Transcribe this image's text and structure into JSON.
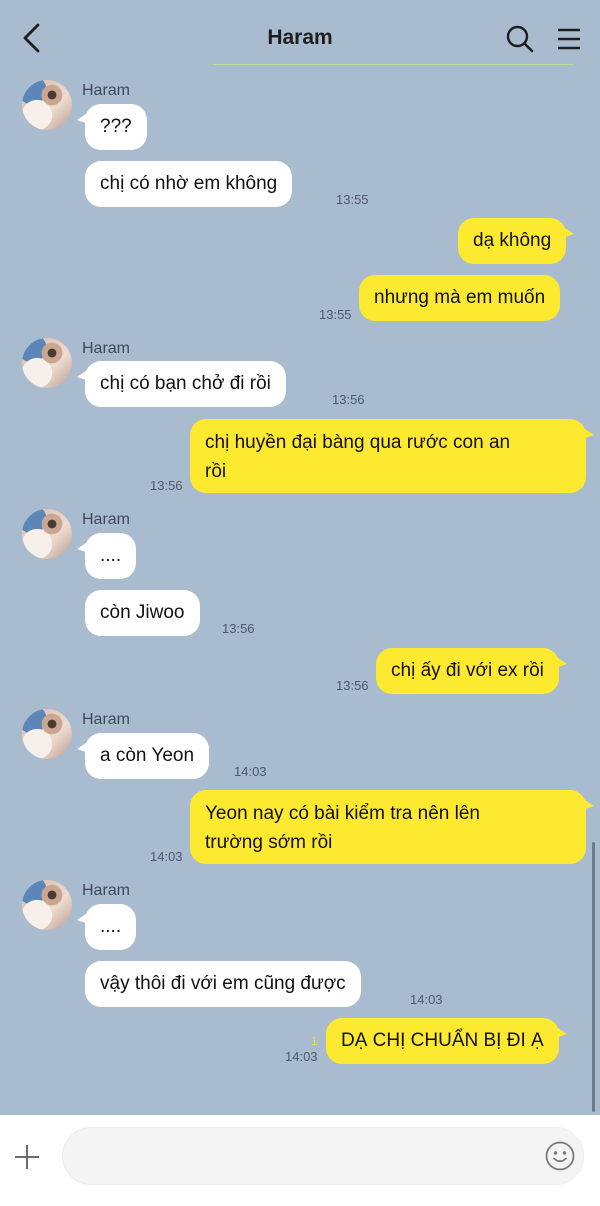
{
  "header": {
    "title": "Haram"
  },
  "contact": {
    "name": "Haram"
  },
  "messages": [
    {
      "from": "in",
      "text": "???"
    },
    {
      "from": "in",
      "text": "chị có nhờ em không",
      "time": "13:55"
    },
    {
      "from": "out",
      "text": "dạ không"
    },
    {
      "from": "out",
      "text": "nhưng mà em muốn",
      "time": "13:55"
    },
    {
      "from": "in",
      "text": "chị có bạn chở đi rồi",
      "time": "13:56"
    },
    {
      "from": "out",
      "text": "chị huyền đại bàng qua rước con an",
      "text2": "rồi",
      "time": "13:56"
    },
    {
      "from": "in",
      "text": "....",
      "time": ""
    },
    {
      "from": "in",
      "text": "còn Jiwoo",
      "time": "13:56"
    },
    {
      "from": "out",
      "text": "chị ấy đi với ex rồi",
      "time": "13:56"
    },
    {
      "from": "in",
      "text": "a còn Yeon",
      "time": "14:03"
    },
    {
      "from": "out",
      "text": "Yeon nay có bài kiểm tra nên lên",
      "text2": "trường sớm rồi",
      "time": "14:03"
    },
    {
      "from": "in",
      "text": "...."
    },
    {
      "from": "in",
      "text": "vậy thôi đi với em cũng được",
      "time": "14:03"
    },
    {
      "from": "out",
      "text": "DẠ CHỊ CHUẨN BỊ ĐI Ạ",
      "time": "14:03",
      "unread": "1"
    }
  ],
  "input": {
    "placeholder": "",
    "value": ""
  },
  "icons": {
    "back": "chevron-left-icon",
    "search": "search-icon",
    "menu": "menu-icon",
    "plus": "plus-icon",
    "emoji": "emoji-icon"
  },
  "colors": {
    "background": "#a9bbce",
    "incoming": "#ffffff",
    "outgoing": "#fde92f"
  }
}
